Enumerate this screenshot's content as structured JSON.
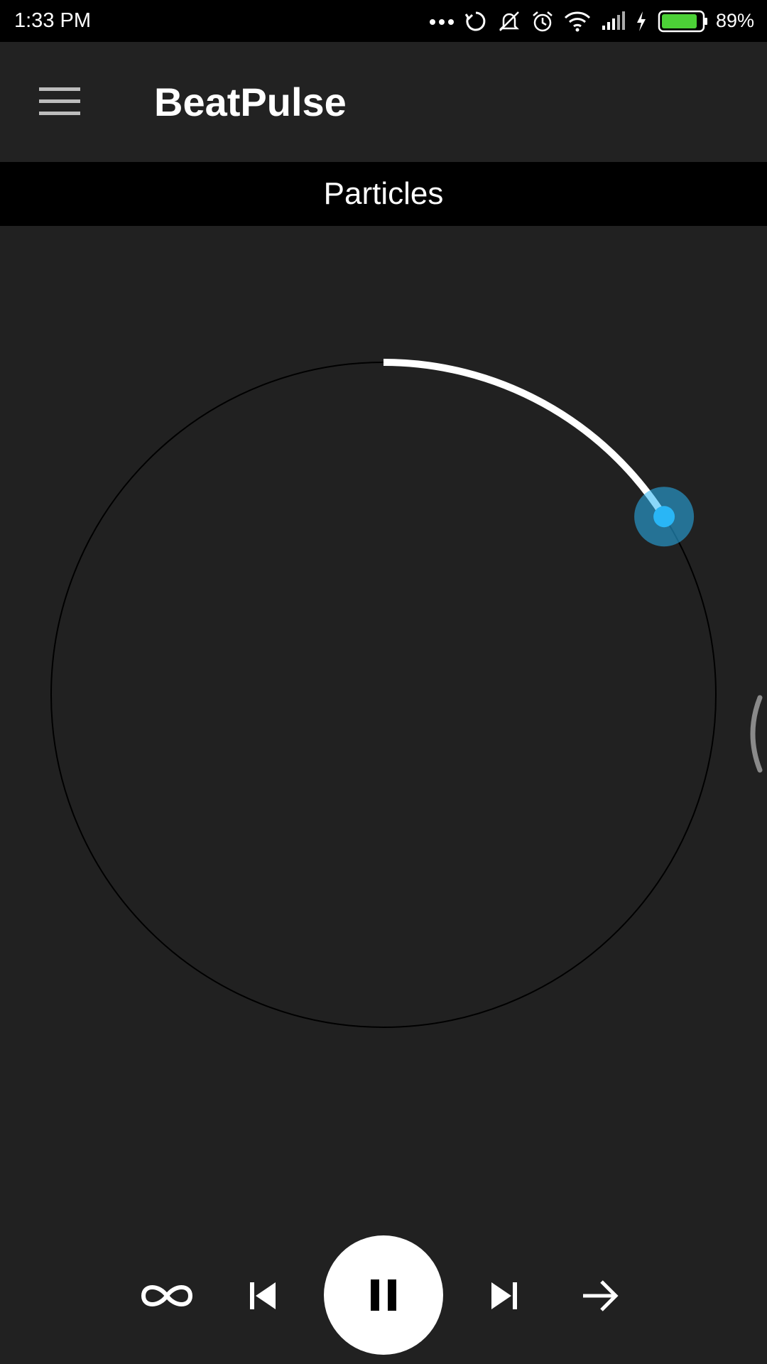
{
  "status_bar": {
    "time": "1:33 PM",
    "battery_percent": "89%",
    "battery_level": 0.89,
    "battery_color": "#4cd137",
    "icons": [
      "more-dots-icon",
      "sync-icon",
      "mute-notification-icon",
      "alarm-icon",
      "wifi-icon",
      "signal-icon",
      "charging-icon",
      "battery-icon"
    ]
  },
  "app_bar": {
    "title": "BeatPulse",
    "menu_icon": "hamburger-menu-icon"
  },
  "visualizer": {
    "name": "Particles"
  },
  "seek": {
    "progress": 0.16,
    "track_color": "#000000",
    "progress_color": "#ffffff",
    "thumb_color": "#29b6f6"
  },
  "controls": {
    "repeat_icon": "infinity-icon",
    "previous_icon": "skip-previous-icon",
    "play_state_icon": "pause-icon",
    "next_icon": "skip-next-icon",
    "forward_icon": "arrow-right-icon"
  },
  "colors": {
    "background": "#212121",
    "accent": "#29b6f6"
  }
}
